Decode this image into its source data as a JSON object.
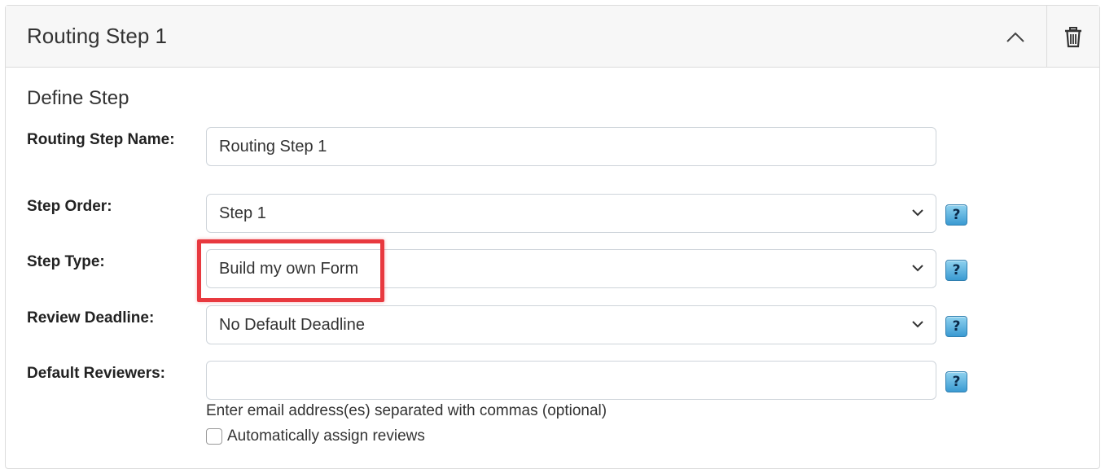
{
  "panel": {
    "title": "Routing Step 1",
    "collapse_icon": "chevron-up-icon",
    "delete_icon": "trash-icon"
  },
  "section": {
    "title": "Define Step"
  },
  "fields": {
    "name": {
      "label": "Routing Step Name:",
      "value": "Routing Step 1"
    },
    "order": {
      "label": "Step Order:",
      "value": "Step 1",
      "help": "?"
    },
    "type": {
      "label": "Step Type:",
      "value": "Build my own Form",
      "help": "?"
    },
    "deadline": {
      "label": "Review Deadline:",
      "value": "No Default Deadline",
      "help": "?"
    },
    "reviewers": {
      "label": "Default Reviewers:",
      "value": "",
      "help": "?",
      "hint": "Enter email address(es) separated with commas (optional)",
      "checkbox_label": "Automatically assign reviews",
      "checkbox_checked": false
    }
  },
  "colors": {
    "highlight": "#e8393f",
    "help_button": "#3a9ad2"
  }
}
